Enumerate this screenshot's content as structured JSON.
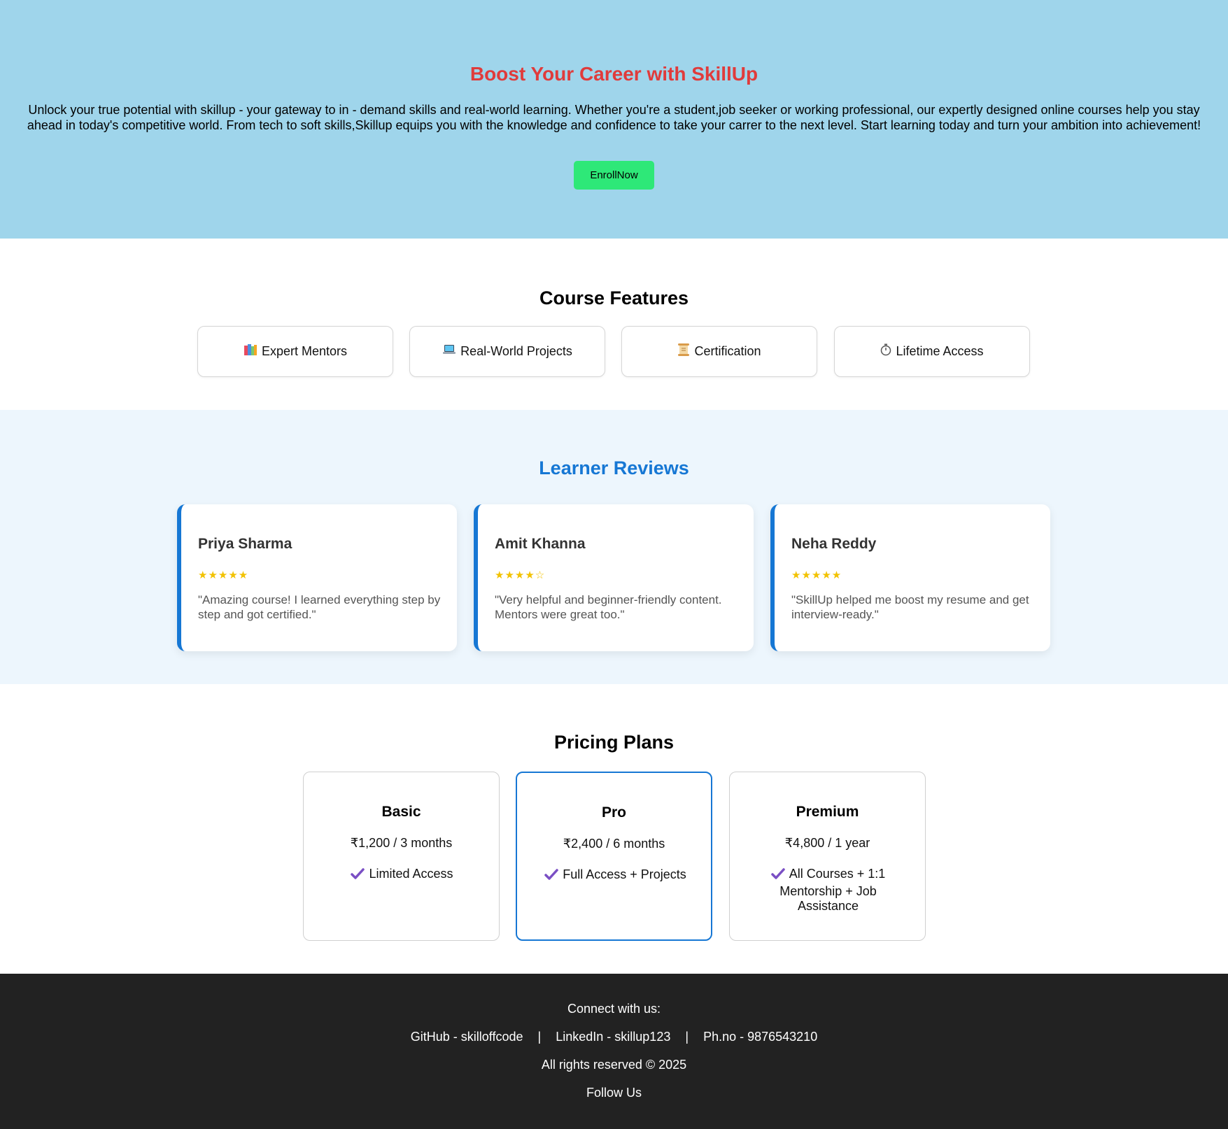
{
  "hero": {
    "title": "Boost Your Career with SkillUp",
    "description": "Unlock your true potential with skillup - your gateway to in - demand skills and real-world learning. Whether you're a student,job seeker or working professional, our expertly designed online courses help you stay ahead in today's competitive world. From tech to soft skills,Skillup equips you with the knowledge and confidence to take your carrer to the next level. Start learning today and turn your ambition into achievement!",
    "cta_label": "EnrollNow"
  },
  "features": {
    "title": "Course Features",
    "items": [
      {
        "icon": "books-icon",
        "label": "Expert Mentors"
      },
      {
        "icon": "laptop-icon",
        "label": "Real-World Projects"
      },
      {
        "icon": "scroll-icon",
        "label": "Certification"
      },
      {
        "icon": "stopwatch-icon",
        "label": "Lifetime Access"
      }
    ]
  },
  "reviews": {
    "title": "Learner Reviews",
    "items": [
      {
        "name": "Priya Sharma",
        "rating": 5,
        "stars": "★★★★★",
        "text": "\"Amazing course! I learned everything step by step and got certified.\""
      },
      {
        "name": "Amit Khanna",
        "rating": 4,
        "stars": "★★★★☆",
        "text": "\"Very helpful and beginner-friendly content. Mentors were great too.\""
      },
      {
        "name": "Neha Reddy",
        "rating": 5,
        "stars": "★★★★★",
        "text": "\"SkillUp helped me boost my resume and get interview-ready.\""
      }
    ]
  },
  "pricing": {
    "title": "Pricing Plans",
    "plans": [
      {
        "name": "Basic",
        "price": "₹1,200 / 3 months",
        "feature": "Limited Access",
        "highlighted": false
      },
      {
        "name": "Pro",
        "price": "₹2,400 / 6 months",
        "feature": "Full Access + Projects",
        "highlighted": true
      },
      {
        "name": "Premium",
        "price": "₹4,800 / 1 year",
        "feature": "All Courses + 1:1 Mentorship + Job Assistance",
        "highlighted": false
      }
    ]
  },
  "footer": {
    "connect": "Connect with us:",
    "github": "GitHub - skilloffcode",
    "separator": "|",
    "linkedin": "LinkedIn - skillup123",
    "phone": "Ph.no - 9876543210",
    "copyright": "All rights reserved © 2025",
    "follow": "Follow Us"
  },
  "colors": {
    "hero_bg": "#9fd5eb",
    "hero_title": "#e03b3b",
    "cta_bg": "#2ee878",
    "accent_blue": "#1677d4",
    "reviews_bg": "#edf6fd",
    "star": "#f2c200",
    "check": "#7a4fc4",
    "footer_bg": "#222222"
  }
}
